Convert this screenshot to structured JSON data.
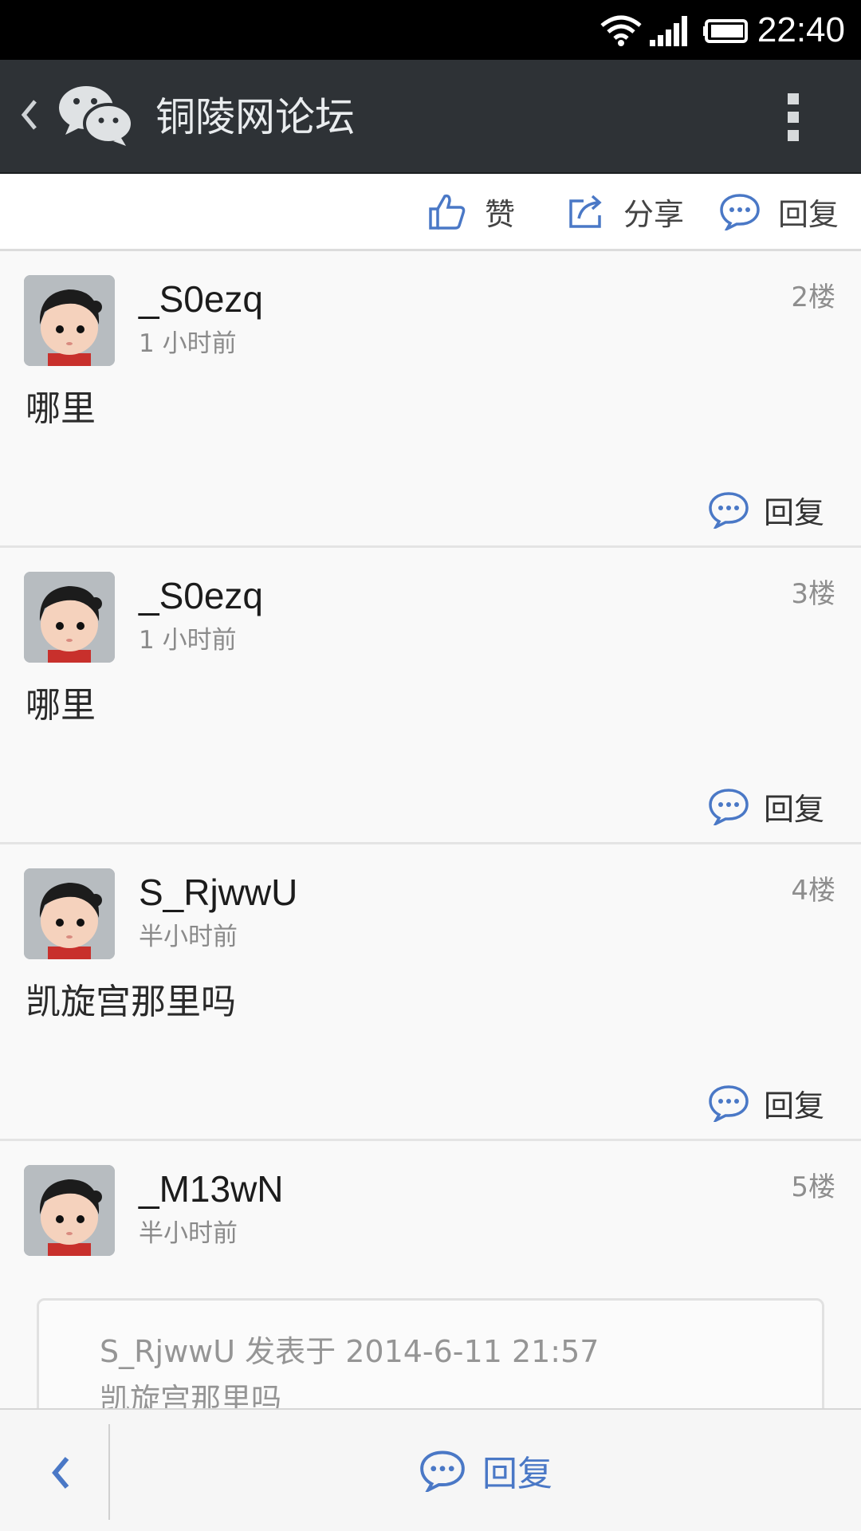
{
  "status_bar": {
    "time": "22:40"
  },
  "header": {
    "title": "铜陵网论坛"
  },
  "actions": {
    "like": "赞",
    "share": "分享",
    "reply": "回复"
  },
  "posts": [
    {
      "username": "_S0ezq",
      "time": "1 小时前",
      "floor": "2楼",
      "content": "哪里",
      "reply": "回复"
    },
    {
      "username": "_S0ezq",
      "time": "1 小时前",
      "floor": "3楼",
      "content": "哪里",
      "reply": "回复"
    },
    {
      "username": "S_RjwwU",
      "time": "半小时前",
      "floor": "4楼",
      "content": "凯旋宫那里吗",
      "reply": "回复"
    },
    {
      "username": "_M13wN",
      "time": "半小时前",
      "floor": "5楼",
      "quote": {
        "line1": "S_RjwwU 发表于 2014-6-11 21:57",
        "line2": "凯旋宫那里吗"
      }
    }
  ],
  "bottom_bar": {
    "reply": "回复"
  },
  "colors": {
    "accent": "#4a78c6",
    "header_bg": "#2e3236"
  }
}
